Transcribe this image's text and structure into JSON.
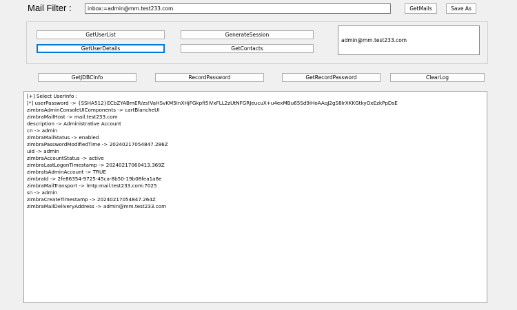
{
  "header": {
    "label": "Mail Filter :",
    "filter_value": "inbox:=admin@mm.test233.com",
    "get_mails_label": "GetMails",
    "save_as_label": "Save As"
  },
  "actions": {
    "get_user_list_label": "GetUserList",
    "generate_session_label": "GenerateSession",
    "get_user_details_label": "GetUserDetails",
    "get_contacts_label": "GetContacts",
    "session_text": "admin@mm.test233.com"
  },
  "toolbar": {
    "get_jdbc_info_label": "GetJDBCInfo",
    "record_password_label": "RecordPassword",
    "get_record_password_label": "GetRecordPassword",
    "clear_log_label": "ClearLog"
  },
  "output": {
    "lines": [
      "[+]  Select UserInfo :",
      "[*] userPassword -> {SSHA512}ECbZYABmER/zs!VaHSvKM5InXHjFGkpfI5iVxFLL2zUtNFGRJeucuX+u4exMBu65Sd9iHoAAqJ2gS8IrXKKGtkyOxEzkPpDsE",
      "zimbraAdminConsoleUIComponents -> cartBlancheUI",
      "zimbraMailHost -> mail.test233.com",
      "description -> Administrative Account",
      "cn -> admin",
      "zimbraMailStatus -> enabled",
      "zimbraPasswordModifiedTime -> 20240217054847.286Z",
      "uid -> admin",
      "zimbraAccountStatus -> active",
      "zimbraLastLogonTimestamp -> 20240217060413.369Z",
      "zimbraIsAdminAccount -> TRUE",
      "zimbraId -> 2fe86354-9725-45ca-8b50-19b08fea1a8e",
      "zimbraMailTransport -> lmtp:mail.test233.com:7025",
      "sn -> admin",
      "zimbraCreateTimestamp -> 20240217054847.264Z",
      "zimbraMailDeliveryAddress -> admin@mm.test233.com"
    ]
  }
}
